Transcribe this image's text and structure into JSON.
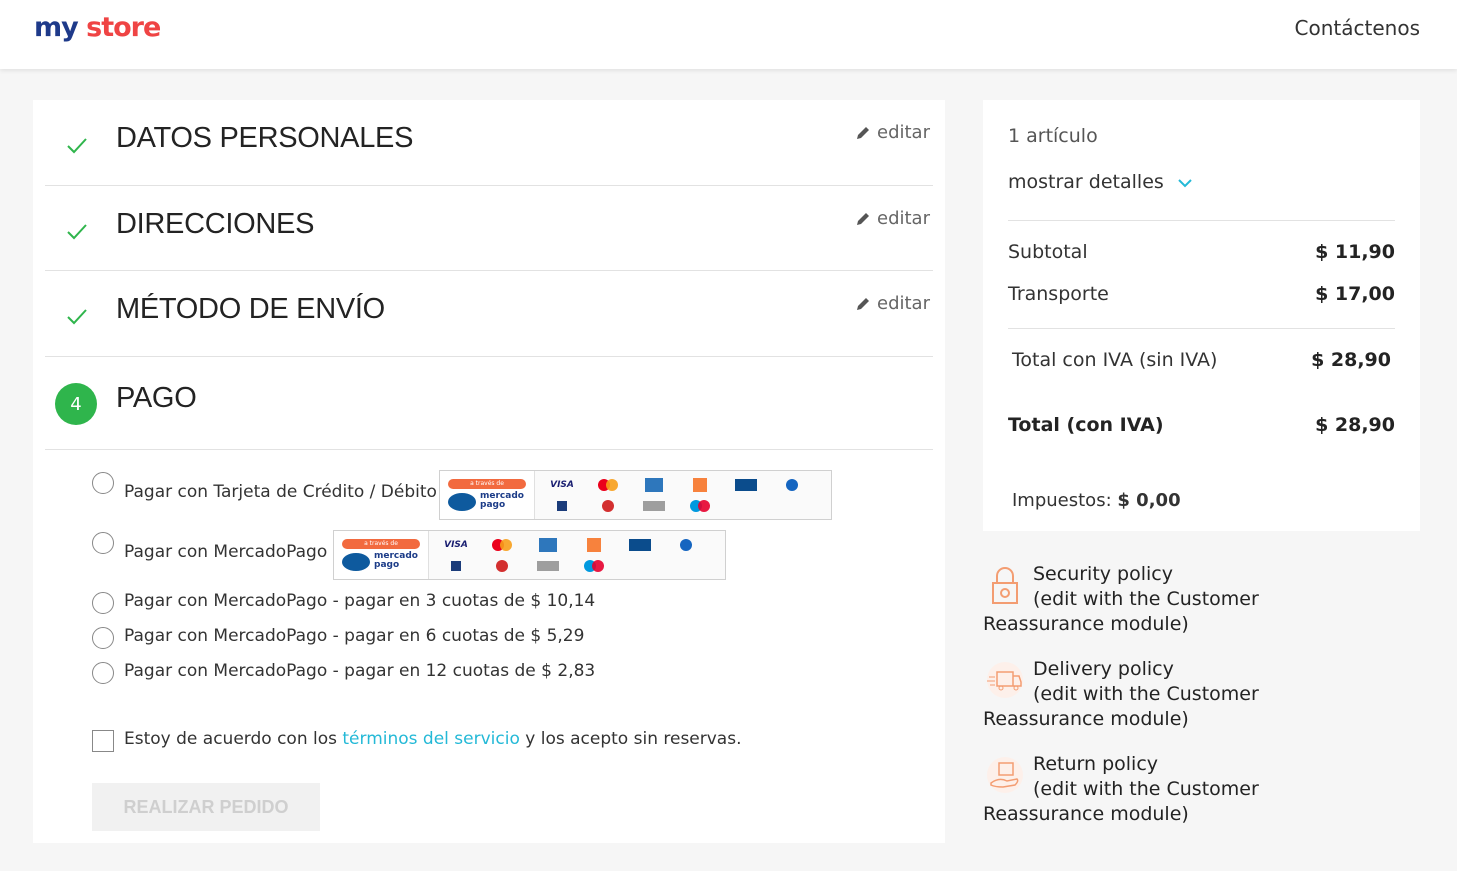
{
  "header": {
    "logo_part1": "my",
    "logo_part2": "store",
    "contact_label": "Contáctenos"
  },
  "steps": [
    {
      "title": "DATOS PERSONALES",
      "edit": "editar",
      "status": "complete"
    },
    {
      "title": "DIRECCIONES",
      "edit": "editar",
      "status": "complete"
    },
    {
      "title": "MÉTODO DE ENVÍO",
      "edit": "editar",
      "status": "complete"
    },
    {
      "number": "4",
      "title": "PAGO",
      "status": "current"
    }
  ],
  "payment_options": [
    {
      "label": "Pagar con Tarjeta de Crédito / Débito",
      "has_logo": true
    },
    {
      "label": "Pagar con MercadoPago",
      "has_logo": true
    },
    {
      "label": "Pagar con MercadoPago - pagar en 3 cuotas de $ 10,14"
    },
    {
      "label": "Pagar con MercadoPago - pagar en 6 cuotas de $ 5,29"
    },
    {
      "label": "Pagar con MercadoPago - pagar en 12 cuotas de $ 2,83"
    }
  ],
  "mp_logo": {
    "band": "a través de",
    "brand_line1": "mercado",
    "brand_line2": "pago",
    "cards": [
      "VISA",
      "mastercard",
      "amex",
      "naranja",
      "cabal",
      "argencard",
      "nativa",
      "diners",
      "cordobesa",
      "maestro"
    ]
  },
  "terms": {
    "before": "Estoy de acuerdo con los ",
    "link": "términos del servicio",
    "after": " y los acepto sin reservas."
  },
  "place_order_button": "REALIZAR PEDIDO",
  "summary": {
    "items_count": "1 artículo",
    "show_details": "mostrar detalles",
    "subtotal_label": "Subtotal",
    "subtotal_value": "$ 11,90",
    "shipping_label": "Transporte",
    "shipping_value": "$ 17,00",
    "total_excl_label": "Total con IVA (sin IVA)",
    "total_excl_value": "$ 28,90",
    "total_incl_label": "Total (con IVA)",
    "total_incl_value": "$ 28,90",
    "taxes_label": "Impuestos:",
    "taxes_value": "$ 0,00"
  },
  "reassurance": [
    {
      "icon": "lock-icon",
      "title": "Security policy",
      "desc": "(edit with the Customer Reassurance module)"
    },
    {
      "icon": "truck-icon",
      "title": "Delivery policy",
      "desc": "(edit with the Customer Reassurance module)"
    },
    {
      "icon": "return-box-icon",
      "title": "Return policy",
      "desc": "(edit with the Customer Reassurance module)"
    }
  ],
  "colors": {
    "accent": "#24b9d7",
    "success": "#2fb54c",
    "icon_orange": "#f39d72"
  }
}
